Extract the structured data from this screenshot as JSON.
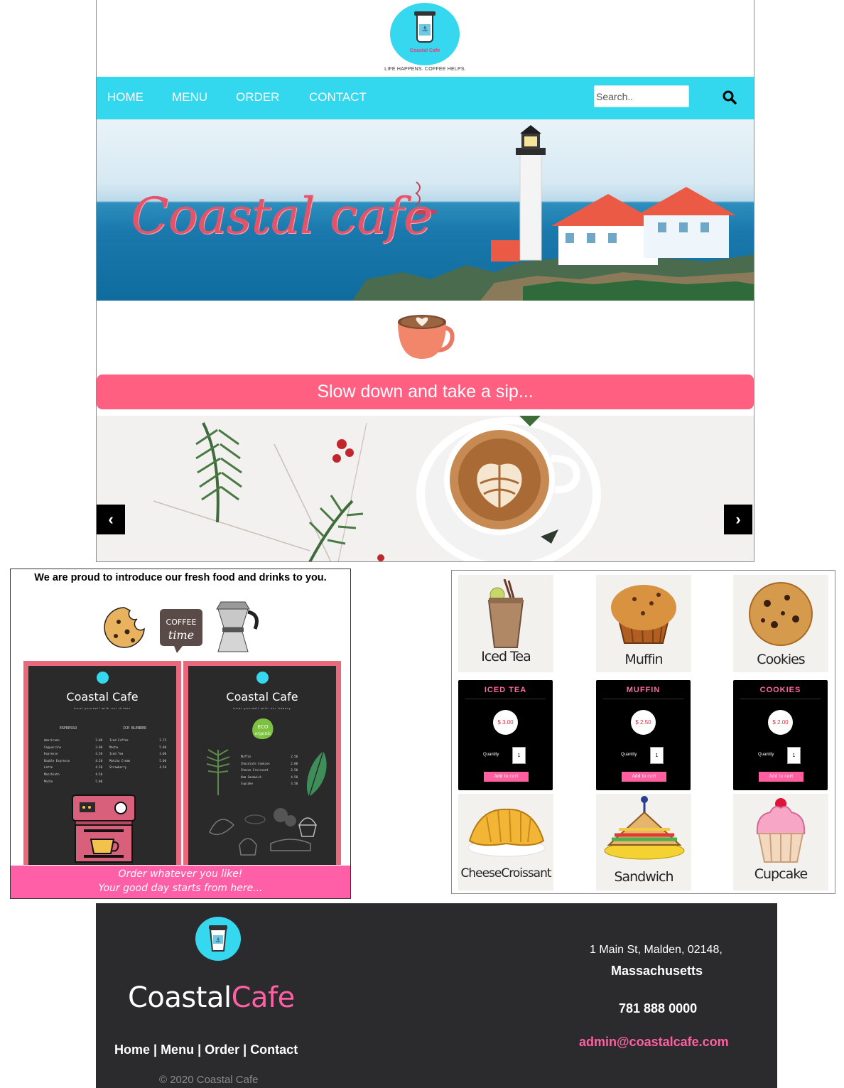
{
  "brand": {
    "badge_text": "Coastal Cafe",
    "tagline": "LIFE HAPPENS. COFFEE HELPS.",
    "hero_title": "Coastal cafe"
  },
  "nav": {
    "items": [
      {
        "label": "HOME"
      },
      {
        "label": "MENU"
      },
      {
        "label": "ORDER"
      },
      {
        "label": "CONTACT"
      }
    ],
    "search_placeholder": "Search.."
  },
  "banner": {
    "text": "Slow down and take a sip..."
  },
  "carousel": {
    "prev": "‹",
    "next": "›"
  },
  "intro": {
    "text": "We are proud to introduce our fresh food and drinks to you.",
    "coffee_time": [
      "COFFEE",
      "time"
    ]
  },
  "menu_boards": [
    {
      "title": "Coastal Cafe",
      "subtitle": "treat yourself with our drinks",
      "sections": [
        {
          "heading": "ESPRESSO",
          "items": [
            [
              "Americano",
              "3.00"
            ],
            [
              "Cappuccino",
              "3.00"
            ],
            [
              "Espresso",
              "3.50"
            ],
            [
              "Double Espresso",
              "4.20"
            ],
            [
              "Latte",
              "4.50"
            ],
            [
              "Macchiato",
              "4.50"
            ],
            [
              "Mocha",
              "5.00"
            ]
          ]
        },
        {
          "heading": "ICE BLENDED",
          "items": [
            [
              "Iced Coffee",
              "2.75"
            ],
            [
              "Mocha",
              "5.00"
            ],
            [
              "Iced Tea",
              "3.00"
            ],
            [
              "Matcha Cream",
              "5.00"
            ],
            [
              "Strawberry",
              "4.50"
            ]
          ]
        }
      ]
    },
    {
      "title": "Coastal Cafe",
      "subtitle": "treat yourself with our bakery",
      "badge": [
        "ECO",
        "organic"
      ],
      "items": [
        [
          "Muffin",
          "2.50"
        ],
        [
          "Chocolate Cookies",
          "2.00"
        ],
        [
          "Cheese Croissant",
          "2.50"
        ],
        [
          "Ham Sandwich",
          "4.50"
        ],
        [
          "Cupcake",
          "3.50"
        ]
      ]
    }
  ],
  "panel_footer": {
    "line1": "Order whatever you like!",
    "line2": "Your good day starts from here..."
  },
  "products": {
    "top": [
      "Iced Tea",
      "Muffin",
      "Cookies"
    ],
    "bottom": [
      "CheeseCroissant",
      "Sandwich",
      "Cupcake"
    ],
    "cards": [
      {
        "title": "ICED TEA",
        "price": "$ 3.00",
        "qty_label": "Quantity",
        "qty": "1",
        "add": "Add to cart"
      },
      {
        "title": "MUFFIN",
        "price": "$ 2.50",
        "qty_label": "Quantity",
        "qty": "1",
        "add": "Add to cart"
      },
      {
        "title": "COOKIES",
        "price": "$ 2.00",
        "qty_label": "Quantity",
        "qty": "1",
        "add": "Add to cart"
      }
    ]
  },
  "footer": {
    "brand_a": "Coastal",
    "brand_b": "Cafe",
    "links": [
      "Home",
      "Menu",
      "Order",
      "Contact"
    ],
    "separator": " | ",
    "copyright": "© 2020 Coastal Cafe",
    "address_line1": "1 Main St, Malden, 02148,",
    "address_line2": "Massachusetts",
    "phone": "781 888 0000",
    "email": "admin@coastalcafe.com"
  },
  "colors": {
    "nav": "#33d8ef",
    "pink": "#ff6082",
    "footer_bg": "#2b2b2d",
    "accent": "#ff5fa3"
  }
}
